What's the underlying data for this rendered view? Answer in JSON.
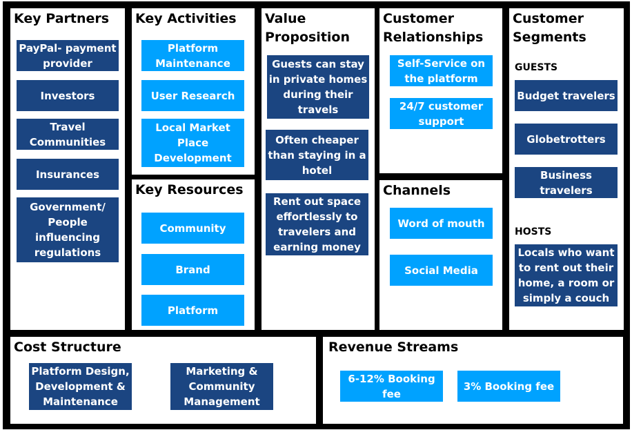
{
  "colors": {
    "dark_box": "#1b4581",
    "light_box": "#00a2ff",
    "border": "#000000"
  },
  "key_partners": {
    "title": "Key Partners",
    "items": [
      "PayPal- payment provider",
      "Investors",
      "Travel Communities",
      "Insurances",
      "Government/ People influencing regulations"
    ]
  },
  "key_activities": {
    "title": "Key Activities",
    "items": [
      "Platform Maintenance",
      "User Research",
      "Local Market Place Development"
    ]
  },
  "key_resources": {
    "title": "Key Resources",
    "items": [
      "Community",
      "Brand",
      "Platform"
    ]
  },
  "value_proposition": {
    "title": "Value Proposition",
    "items": [
      "Guests can stay in private homes during their travels",
      "Often  cheaper than staying in a hotel",
      "Rent out space effortlessly to travelers and earning money"
    ]
  },
  "customer_relationships": {
    "title": "Customer Relationships",
    "items": [
      "Self-Service on the platform",
      "24/7 customer support"
    ]
  },
  "channels": {
    "title": "Channels",
    "items": [
      "Word of mouth",
      "Social Media"
    ]
  },
  "customer_segments": {
    "title": "Customer Segments",
    "guests_label": "GUESTS",
    "guests": [
      "Budget travelers",
      "Globetrotters",
      "Business travelers"
    ],
    "hosts_label": "HOSTS",
    "hosts": [
      "Locals who want to rent out their home, a room or simply a couch"
    ]
  },
  "cost_structure": {
    "title": "Cost Structure",
    "items": [
      "Platform Design, Development & Maintenance",
      "Marketing  & Community Management"
    ]
  },
  "revenue_streams": {
    "title": "Revenue Streams",
    "items": [
      "6-12% Booking fee",
      "3% Booking fee"
    ]
  }
}
